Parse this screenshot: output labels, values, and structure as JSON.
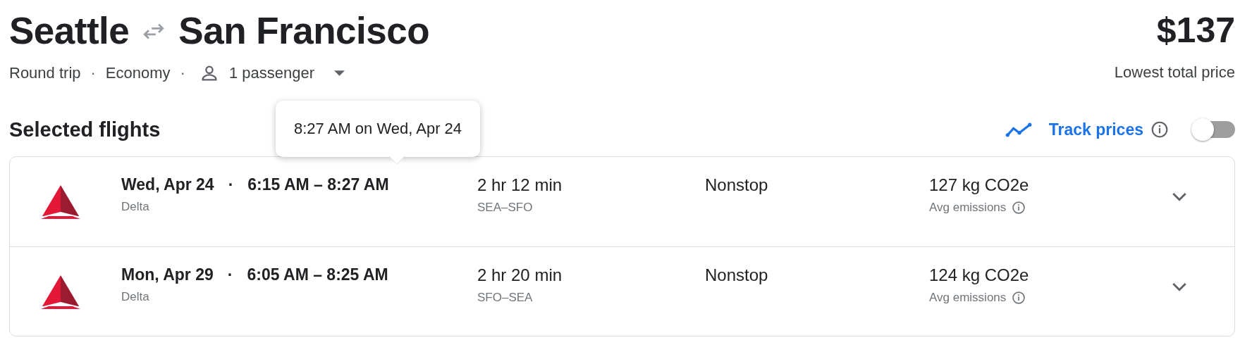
{
  "header": {
    "origin": "Seattle",
    "destination": "San Francisco",
    "trip_type": "Round trip",
    "cabin_class": "Economy",
    "passengers": "1 passenger",
    "separator": "·",
    "price": "$137",
    "price_label": "Lowest total price"
  },
  "section": {
    "title": "Selected flights",
    "track_prices": {
      "label": "Track prices",
      "on": false
    }
  },
  "tooltip": {
    "text": "8:27 AM on Wed, Apr 24"
  },
  "flights": [
    {
      "date": "Wed, Apr 24",
      "separator": "·",
      "times": "6:15 AM – 8:27 AM",
      "airline": "Delta",
      "duration": "2 hr 12 min",
      "route": "SEA–SFO",
      "stops": "Nonstop",
      "emissions": "127 kg CO2e",
      "emissions_label": "Avg emissions",
      "expanded": false
    },
    {
      "date": "Mon, Apr 29",
      "separator": "·",
      "times": "6:05 AM – 8:25 AM",
      "airline": "Delta",
      "duration": "2 hr 20 min",
      "route": "SFO–SEA",
      "stops": "Nonstop",
      "emissions": "124 kg CO2e",
      "emissions_label": "Avg emissions",
      "expanded": false
    }
  ]
}
